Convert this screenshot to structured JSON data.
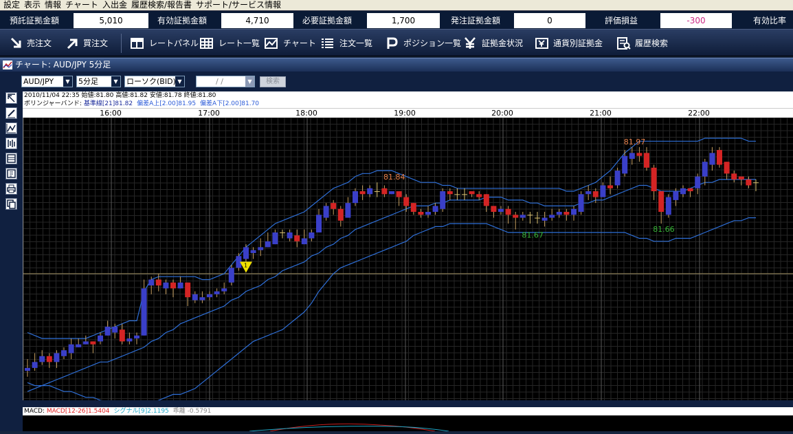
{
  "menu": [
    "設定",
    "表示",
    "情報",
    "チャート",
    "入出金",
    "履歴検索/報告書",
    "サポート/サービス情報"
  ],
  "summary": [
    {
      "label": "預託証拠金額",
      "value": "5,010"
    },
    {
      "label": "有効証拠金額",
      "value": "4,710"
    },
    {
      "label": "必要証拠金額",
      "value": "1,700"
    },
    {
      "label": "発注証拠金額",
      "value": "0"
    },
    {
      "label": "評価損益",
      "value": "-300"
    },
    {
      "label": "有効比率",
      "value": ""
    }
  ],
  "colors": {
    "negative": "#cc2a86",
    "up_candle": "#d42424",
    "down_candle": "#3a3fc8",
    "band": "#2e6fd8",
    "high_label": "#e8804a",
    "low_label": "#38b838",
    "marker": "#f0e000"
  },
  "toolbar": [
    {
      "label": "売注文",
      "icon": "sell-arrow-icon"
    },
    {
      "label": "買注文",
      "icon": "buy-arrow-icon"
    },
    {
      "label": "レートパネル",
      "icon": "rate-panel-icon"
    },
    {
      "label": "レート一覧",
      "icon": "rate-list-icon"
    },
    {
      "label": "チャート",
      "icon": "chart-icon"
    },
    {
      "label": "注文一覧",
      "icon": "order-list-icon"
    },
    {
      "label": "ポジション一覧",
      "icon": "position-icon"
    },
    {
      "label": "証拠金状況",
      "icon": "yen-icon"
    },
    {
      "label": "通貨別証拠金",
      "icon": "currency-icon"
    },
    {
      "label": "履歴検索",
      "icon": "history-icon"
    }
  ],
  "window_title": "チャート: AUD/JPY 5分足",
  "controls": {
    "pair": "AUD/JPY",
    "timeframe": "5分足",
    "chart_type": "ローソク(BID)",
    "date": "/ /",
    "search": "検索"
  },
  "ohlc_line": "2010/11/04 22:35  始値:81.80  高値:81.82  安値:81.78  終値:81.80",
  "bollinger": {
    "prefix": "ボリンジャーバンド: ",
    "base": "基準線[21]81.82",
    "upper": "偏差A上[2.00]81.95",
    "lower": "偏差A下[2.00]81.70"
  },
  "macd": {
    "prefix": "MACD: ",
    "macd": "MACD[12-26]1.5404",
    "signal": "シグナル[9]2.1195",
    "divergence": "乖離 -0.5791"
  },
  "chart_data": {
    "type": "candlestick",
    "x_ticks": [
      "16:00",
      "17:00",
      "18:00",
      "19:00",
      "20:00",
      "21:00",
      "22:00"
    ],
    "annotations": [
      {
        "text": "81.84",
        "kind": "high"
      },
      {
        "text": "81.97",
        "kind": "high"
      },
      {
        "text": "81.67",
        "kind": "low"
      },
      {
        "text": "81.66",
        "kind": "low"
      }
    ],
    "marker_label": "1",
    "ylim": [
      81.22,
      82.18
    ],
    "horizontal_line": 81.65,
    "candles": [
      [
        81.33,
        81.32,
        81.36,
        81.3
      ],
      [
        81.35,
        81.33,
        81.38,
        81.32
      ],
      [
        81.37,
        81.35,
        81.39,
        81.34
      ],
      [
        81.35,
        81.37,
        81.38,
        81.33
      ],
      [
        81.38,
        81.35,
        81.39,
        81.33
      ],
      [
        81.39,
        81.37,
        81.4,
        81.36
      ],
      [
        81.41,
        81.38,
        81.43,
        81.36
      ],
      [
        81.41,
        81.4,
        81.43,
        81.4
      ],
      [
        81.42,
        81.41,
        81.44,
        81.41
      ],
      [
        81.41,
        81.42,
        81.42,
        81.38
      ],
      [
        81.44,
        81.42,
        81.45,
        81.41
      ],
      [
        81.47,
        81.44,
        81.49,
        81.44
      ],
      [
        81.47,
        81.45,
        81.48,
        81.43
      ],
      [
        81.42,
        81.46,
        81.48,
        81.41
      ],
      [
        81.43,
        81.42,
        81.45,
        81.41
      ],
      [
        81.44,
        81.43,
        81.45,
        81.41
      ],
      [
        81.6,
        81.44,
        81.63,
        81.44
      ],
      [
        81.63,
        81.61,
        81.64,
        81.58
      ],
      [
        81.61,
        81.63,
        81.65,
        81.59
      ],
      [
        81.62,
        81.6,
        81.63,
        81.58
      ],
      [
        81.6,
        81.62,
        81.63,
        81.57
      ],
      [
        81.62,
        81.6,
        81.64,
        81.6
      ],
      [
        81.57,
        81.62,
        81.62,
        81.54
      ],
      [
        81.58,
        81.56,
        81.59,
        81.55
      ],
      [
        81.57,
        81.56,
        81.59,
        81.55
      ],
      [
        81.58,
        81.57,
        81.59,
        81.56
      ],
      [
        81.59,
        81.58,
        81.6,
        81.57
      ],
      [
        81.6,
        81.59,
        81.62,
        81.58
      ],
      [
        81.67,
        81.62,
        81.68,
        81.61
      ],
      [
        81.71,
        81.67,
        81.72,
        81.66
      ],
      [
        81.74,
        81.7,
        81.75,
        81.69
      ],
      [
        81.73,
        81.72,
        81.74,
        81.7
      ],
      [
        81.74,
        81.73,
        81.77,
        81.71
      ],
      [
        81.76,
        81.74,
        81.79,
        81.74
      ],
      [
        81.79,
        81.75,
        81.8,
        81.75
      ],
      [
        81.79,
        81.79,
        81.8,
        81.77
      ],
      [
        81.79,
        81.77,
        81.8,
        81.76
      ],
      [
        81.76,
        81.78,
        81.8,
        81.74
      ],
      [
        81.77,
        81.75,
        81.8,
        81.75
      ],
      [
        81.79,
        81.77,
        81.8,
        81.76
      ],
      [
        81.85,
        81.79,
        81.87,
        81.79
      ],
      [
        81.88,
        81.84,
        81.89,
        81.83
      ],
      [
        81.87,
        81.89,
        81.9,
        81.85
      ],
      [
        81.83,
        81.87,
        81.88,
        81.81
      ],
      [
        81.89,
        81.84,
        81.91,
        81.84
      ],
      [
        81.93,
        81.89,
        81.94,
        81.88
      ],
      [
        81.92,
        81.93,
        81.95,
        81.9
      ],
      [
        81.94,
        81.92,
        81.95,
        81.91
      ],
      [
        81.93,
        81.93,
        81.96,
        81.91
      ],
      [
        81.92,
        81.94,
        81.95,
        81.91
      ],
      [
        81.93,
        81.92,
        81.93,
        81.92
      ],
      [
        81.91,
        81.93,
        81.93,
        81.88
      ],
      [
        81.88,
        81.91,
        81.92,
        81.86
      ],
      [
        81.86,
        81.89,
        81.89,
        81.85
      ],
      [
        81.85,
        81.86,
        81.87,
        81.84
      ],
      [
        81.86,
        81.85,
        81.88,
        81.84
      ],
      [
        81.88,
        81.86,
        81.89,
        81.85
      ],
      [
        81.93,
        81.87,
        81.94,
        81.86
      ],
      [
        81.92,
        81.93,
        81.94,
        81.9
      ],
      [
        81.92,
        81.92,
        81.94,
        81.9
      ],
      [
        81.92,
        81.92,
        81.94,
        81.9
      ],
      [
        81.92,
        81.93,
        81.93,
        81.91
      ],
      [
        81.91,
        81.92,
        81.93,
        81.9
      ],
      [
        81.88,
        81.92,
        81.92,
        81.86
      ],
      [
        81.86,
        81.88,
        81.88,
        81.84
      ],
      [
        81.87,
        81.86,
        81.88,
        81.85
      ],
      [
        81.85,
        81.87,
        81.88,
        81.82
      ],
      [
        81.84,
        81.85,
        81.86,
        81.8
      ],
      [
        81.85,
        81.84,
        81.86,
        81.83
      ],
      [
        81.85,
        81.85,
        81.86,
        81.82
      ],
      [
        81.84,
        81.84,
        81.86,
        81.82
      ],
      [
        81.84,
        81.83,
        81.86,
        81.81
      ],
      [
        81.85,
        81.84,
        81.87,
        81.83
      ],
      [
        81.86,
        81.85,
        81.87,
        81.84
      ],
      [
        81.85,
        81.86,
        81.87,
        81.83
      ],
      [
        81.87,
        81.85,
        81.88,
        81.83
      ],
      [
        81.92,
        81.86,
        81.93,
        81.85
      ],
      [
        81.93,
        81.92,
        81.95,
        81.9
      ],
      [
        81.91,
        81.93,
        81.94,
        81.89
      ],
      [
        81.95,
        81.91,
        81.96,
        81.91
      ],
      [
        81.94,
        81.95,
        81.98,
        81.92
      ],
      [
        82.0,
        81.95,
        82.01,
        81.94
      ],
      [
        82.05,
        81.99,
        82.07,
        81.98
      ],
      [
        82.06,
        82.04,
        82.08,
        82.02
      ],
      [
        82.05,
        82.06,
        82.08,
        82.03
      ],
      [
        82.01,
        82.06,
        82.08,
        82.0
      ],
      [
        81.93,
        82.01,
        82.02,
        81.9
      ],
      [
        81.86,
        81.93,
        81.93,
        81.82
      ],
      [
        81.91,
        81.85,
        81.92,
        81.84
      ],
      [
        81.93,
        81.9,
        81.94,
        81.88
      ],
      [
        81.94,
        81.92,
        81.95,
        81.91
      ],
      [
        81.93,
        81.94,
        81.94,
        81.91
      ],
      [
        81.98,
        81.94,
        81.99,
        81.92
      ],
      [
        82.03,
        81.98,
        82.04,
        81.95
      ],
      [
        82.06,
        82.02,
        82.08,
        82.0
      ],
      [
        82.02,
        82.07,
        82.08,
        82.01
      ],
      [
        81.99,
        82.03,
        82.03,
        81.97
      ],
      [
        81.97,
        81.99,
        82.0,
        81.96
      ],
      [
        81.97,
        81.98,
        81.98,
        81.95
      ],
      [
        81.95,
        81.97,
        81.98,
        81.94
      ],
      [
        81.96,
        81.96,
        81.97,
        81.93
      ]
    ],
    "bb_mid": [
      81.25,
      81.26,
      81.27,
      81.28,
      81.29,
      81.3,
      81.31,
      81.32,
      81.33,
      81.34,
      81.35,
      81.35,
      81.36,
      81.37,
      81.38,
      81.39,
      81.4,
      81.42,
      81.43,
      81.45,
      81.46,
      81.48,
      81.49,
      81.5,
      81.51,
      81.52,
      81.53,
      81.54,
      81.56,
      81.57,
      81.59,
      81.6,
      81.61,
      81.63,
      81.64,
      81.66,
      81.67,
      81.68,
      81.69,
      81.71,
      81.72,
      81.74,
      81.75,
      81.77,
      81.78,
      81.8,
      81.81,
      81.82,
      81.83,
      81.84,
      81.85,
      81.86,
      81.87,
      81.88,
      81.88,
      81.88,
      81.89,
      81.89,
      81.9,
      81.9,
      81.9,
      81.9,
      81.9,
      81.91,
      81.91,
      81.91,
      81.9,
      81.9,
      81.9,
      81.89,
      81.89,
      81.88,
      81.88,
      81.88,
      81.88,
      81.88,
      81.89,
      81.89,
      81.9,
      81.9,
      81.91,
      81.92,
      81.93,
      81.94,
      81.95,
      81.95,
      81.94,
      81.93,
      81.93,
      81.93,
      81.93,
      81.94,
      81.95,
      81.96,
      81.96,
      81.97,
      81.97,
      81.97,
      81.97,
      81.97,
      81.97
    ],
    "bb_upper": [
      81.45,
      81.44,
      81.43,
      81.43,
      81.43,
      81.43,
      81.43,
      81.43,
      81.43,
      81.44,
      81.45,
      81.46,
      81.47,
      81.48,
      81.49,
      81.49,
      81.59,
      81.63,
      81.64,
      81.64,
      81.64,
      81.64,
      81.64,
      81.64,
      81.63,
      81.63,
      81.64,
      81.65,
      81.68,
      81.71,
      81.74,
      81.76,
      81.78,
      81.8,
      81.82,
      81.83,
      81.84,
      81.85,
      81.86,
      81.88,
      81.9,
      81.92,
      81.94,
      81.95,
      81.96,
      81.98,
      81.99,
      81.99,
      82.0,
      82.0,
      82.0,
      81.99,
      81.98,
      81.97,
      81.96,
      81.96,
      81.96,
      81.95,
      81.95,
      81.94,
      81.94,
      81.94,
      81.94,
      81.94,
      81.94,
      81.94,
      81.94,
      81.94,
      81.94,
      81.94,
      81.94,
      81.94,
      81.94,
      81.94,
      81.93,
      81.93,
      81.94,
      81.95,
      81.96,
      81.98,
      82.0,
      82.03,
      82.06,
      82.08,
      82.1,
      82.1,
      82.1,
      82.1,
      82.1,
      82.1,
      82.1,
      82.1,
      82.1,
      82.11,
      82.11,
      82.11,
      82.11,
      82.11,
      82.11,
      82.1,
      82.1
    ],
    "bb_lower": [
      81.28,
      81.27,
      81.27,
      81.27,
      81.26,
      81.25,
      81.25,
      81.24,
      81.23,
      81.23,
      81.22,
      81.21,
      81.21,
      81.2,
      81.19,
      81.19,
      81.2,
      81.21,
      81.22,
      81.23,
      81.24,
      81.24,
      81.25,
      81.26,
      81.28,
      81.3,
      81.32,
      81.34,
      81.36,
      81.38,
      81.4,
      81.42,
      81.43,
      81.44,
      81.45,
      81.46,
      81.48,
      81.5,
      81.52,
      81.55,
      81.59,
      81.62,
      81.65,
      81.67,
      81.68,
      81.69,
      81.7,
      81.71,
      81.72,
      81.73,
      81.74,
      81.75,
      81.76,
      81.78,
      81.79,
      81.8,
      81.81,
      81.81,
      81.82,
      81.82,
      81.82,
      81.82,
      81.82,
      81.82,
      81.81,
      81.8,
      81.79,
      81.79,
      81.79,
      81.79,
      81.79,
      81.79,
      81.79,
      81.79,
      81.79,
      81.79,
      81.79,
      81.79,
      81.79,
      81.79,
      81.79,
      81.79,
      81.79,
      81.78,
      81.77,
      81.77,
      81.76,
      81.76,
      81.76,
      81.77,
      81.77,
      81.77,
      81.78,
      81.79,
      81.8,
      81.81,
      81.82,
      81.83,
      81.83,
      81.84,
      81.84
    ]
  }
}
